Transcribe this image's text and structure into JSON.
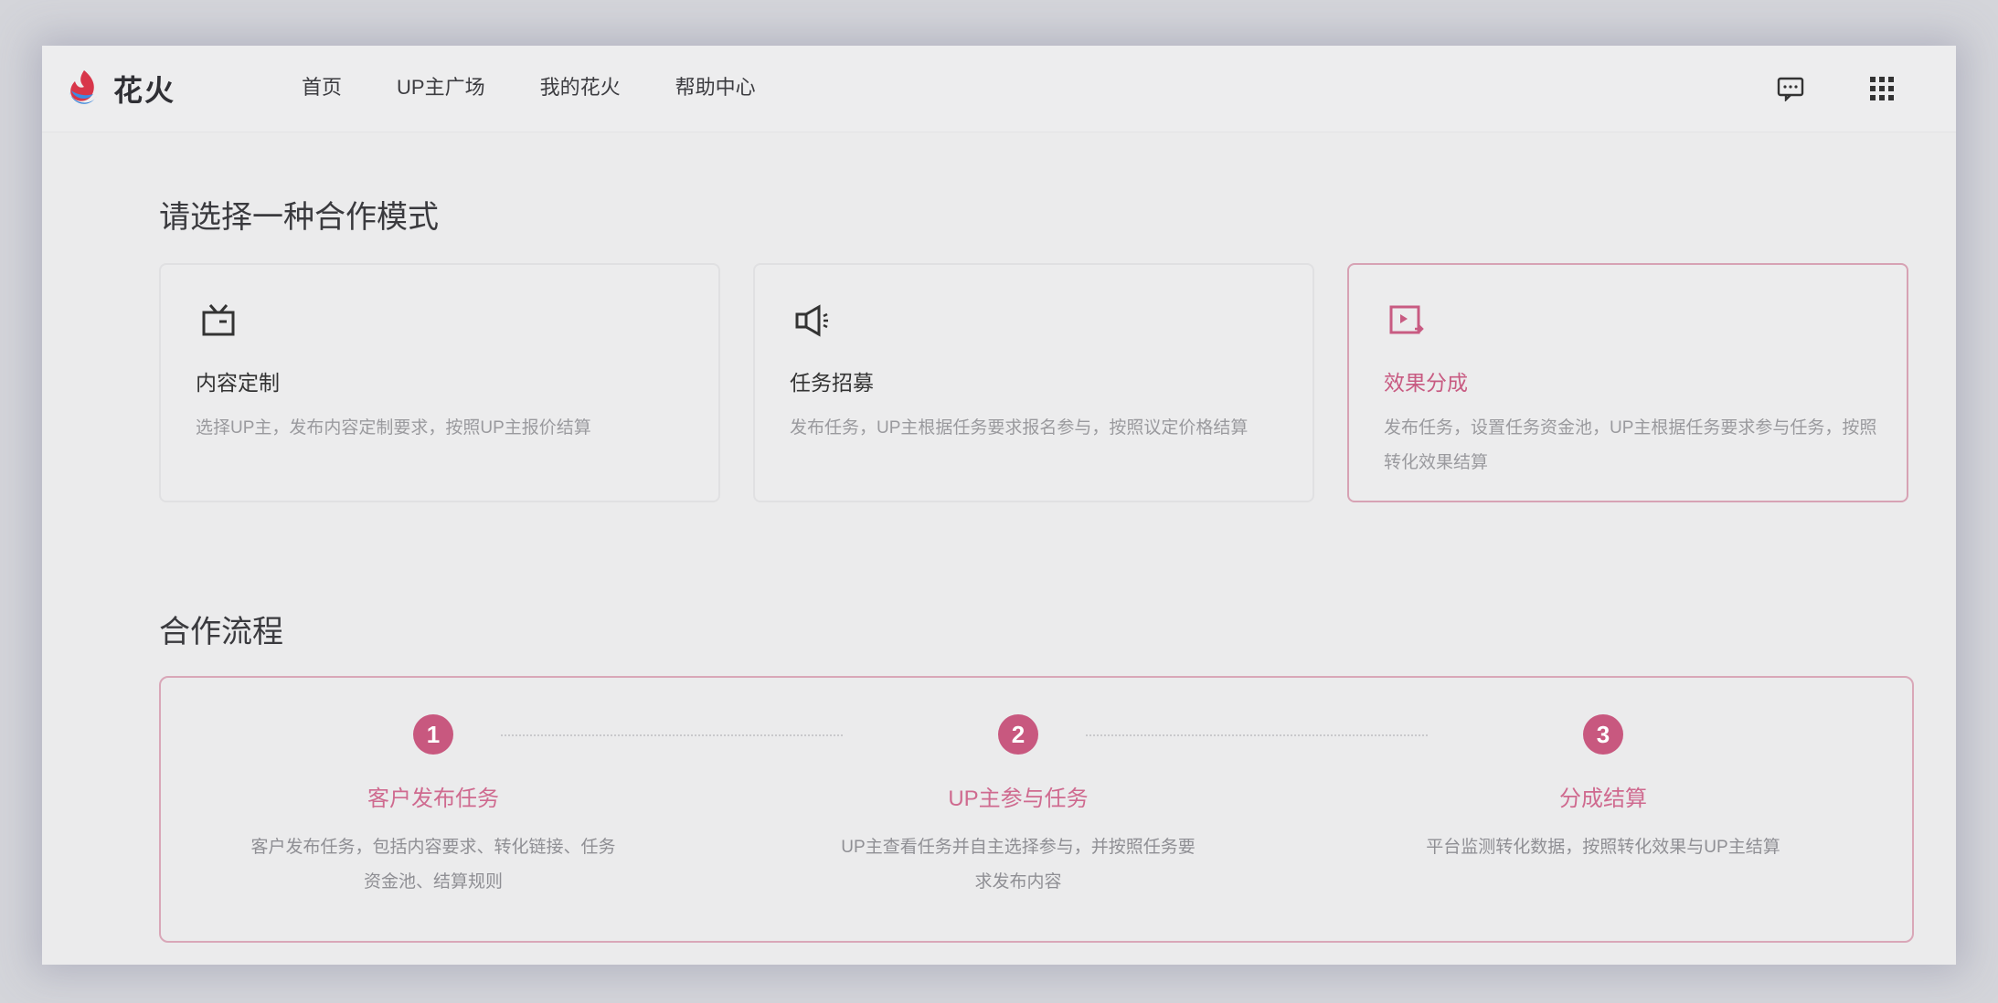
{
  "header": {
    "logo_text": "花火",
    "nav": [
      "首页",
      "UP主广场",
      "我的花火",
      "帮助中心"
    ],
    "icons": {
      "message": "message-icon",
      "apps": "grid-apps-icon"
    }
  },
  "mode_section": {
    "title": "请选择一种合作模式",
    "cards": [
      {
        "icon": "tv-icon",
        "name": "内容定制",
        "desc": "选择UP主，发布内容定制要求，按照UP主报价结算"
      },
      {
        "icon": "megaphone-icon",
        "name": "任务招募",
        "desc": "发布任务，UP主根据任务要求报名参与，按照议定价格结算"
      },
      {
        "icon": "video-share-icon",
        "name": "效果分成",
        "desc": "发布任务，设置任务资金池，UP主根据任务要求参与任务，按照转化效果结算"
      }
    ]
  },
  "flow_section": {
    "title": "合作流程",
    "steps": [
      {
        "num": "1",
        "title": "客户发布任务",
        "desc": "客户发布任务，包括内容要求、转化链接、任务资金池、结算规则"
      },
      {
        "num": "2",
        "title": "UP主参与任务",
        "desc": "UP主查看任务并自主选择参与，并按照任务要求发布内容"
      },
      {
        "num": "3",
        "title": "分成结算",
        "desc": "平台监测转化数据，按照转化效果与UP主结算"
      }
    ]
  },
  "colors": {
    "accent": "#c8587f",
    "accent_border": "#d9a7b8",
    "background": "#ebebec"
  }
}
